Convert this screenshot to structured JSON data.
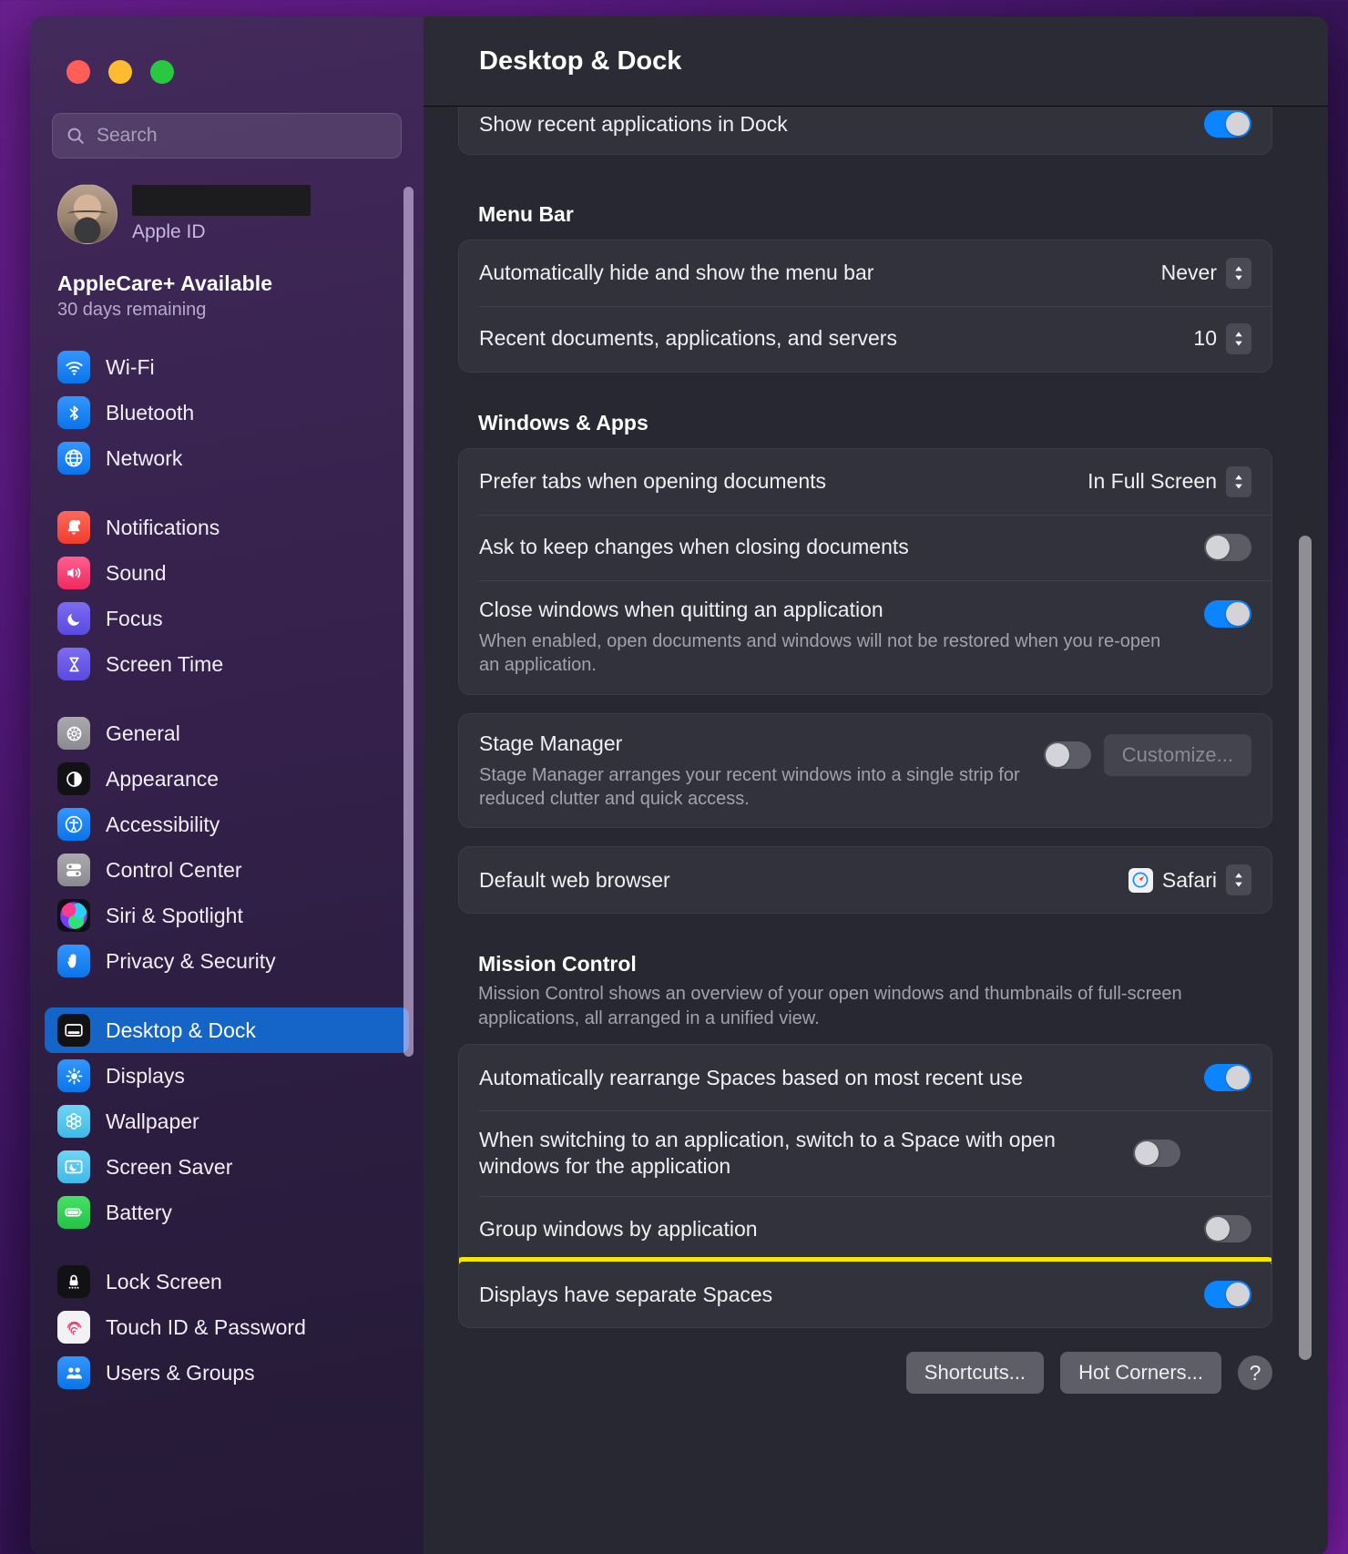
{
  "window": {
    "traffic_lights": [
      "close",
      "minimize",
      "zoom"
    ],
    "colors": {
      "close": "#ff5f57",
      "minimize": "#febc2e",
      "zoom": "#28c840",
      "accent": "#0a84ff",
      "selected_row": "#1565c9",
      "highlight": "#f5e800"
    }
  },
  "sidebar": {
    "search": {
      "placeholder": "Search",
      "value": ""
    },
    "account": {
      "name_redacted": true,
      "subtitle": "Apple ID"
    },
    "applecare": {
      "title": "AppleCare+ Available",
      "subtitle": "30 days remaining"
    },
    "groups": [
      {
        "items": [
          {
            "label": "Wi-Fi",
            "icon": "wifi-icon",
            "selected": false
          },
          {
            "label": "Bluetooth",
            "icon": "bluetooth-icon",
            "selected": false
          },
          {
            "label": "Network",
            "icon": "network-globe-icon",
            "selected": false
          }
        ]
      },
      {
        "items": [
          {
            "label": "Notifications",
            "icon": "notifications-bell-icon",
            "selected": false
          },
          {
            "label": "Sound",
            "icon": "sound-speaker-icon",
            "selected": false
          },
          {
            "label": "Focus",
            "icon": "focus-moon-icon",
            "selected": false
          },
          {
            "label": "Screen Time",
            "icon": "screen-time-hourglass-icon",
            "selected": false
          }
        ]
      },
      {
        "items": [
          {
            "label": "General",
            "icon": "general-gear-icon",
            "selected": false
          },
          {
            "label": "Appearance",
            "icon": "appearance-contrast-icon",
            "selected": false
          },
          {
            "label": "Accessibility",
            "icon": "accessibility-icon",
            "selected": false
          },
          {
            "label": "Control Center",
            "icon": "control-center-toggles-icon",
            "selected": false
          },
          {
            "label": "Siri & Spotlight",
            "icon": "siri-orb-icon",
            "selected": false
          },
          {
            "label": "Privacy & Security",
            "icon": "privacy-hand-icon",
            "selected": false
          }
        ]
      },
      {
        "items": [
          {
            "label": "Desktop & Dock",
            "icon": "desktop-dock-icon",
            "selected": true
          },
          {
            "label": "Displays",
            "icon": "displays-brightness-icon",
            "selected": false
          },
          {
            "label": "Wallpaper",
            "icon": "wallpaper-flower-icon",
            "selected": false
          },
          {
            "label": "Screen Saver",
            "icon": "screen-saver-icon",
            "selected": false
          },
          {
            "label": "Battery",
            "icon": "battery-icon",
            "selected": false
          }
        ]
      },
      {
        "items": [
          {
            "label": "Lock Screen",
            "icon": "lock-screen-padlock-icon",
            "selected": false
          },
          {
            "label": "Touch ID & Password",
            "icon": "touch-id-fingerprint-icon",
            "selected": false
          },
          {
            "label": "Users & Groups",
            "icon": "users-groups-icon",
            "selected": false
          }
        ]
      }
    ]
  },
  "detail": {
    "title": "Desktop & Dock",
    "dock_group": {
      "rows": [
        {
          "label": "Show recent applications in Dock",
          "control": "toggle",
          "value": "on"
        }
      ]
    },
    "menu_bar": {
      "section_title": "Menu Bar",
      "rows": [
        {
          "label": "Automatically hide and show the menu bar",
          "control": "popup",
          "value": "Never"
        },
        {
          "label": "Recent documents, applications, and servers",
          "control": "stepper",
          "value": "10"
        }
      ]
    },
    "windows_apps": {
      "section_title": "Windows & Apps",
      "rows": [
        {
          "label": "Prefer tabs when opening documents",
          "control": "popup",
          "value": "In Full Screen"
        },
        {
          "label": "Ask to keep changes when closing documents",
          "control": "toggle",
          "value": "off"
        },
        {
          "label": "Close windows when quitting an application",
          "sub": "When enabled, open documents and windows will not be restored when you re-open an application.",
          "control": "toggle",
          "value": "on"
        }
      ],
      "stage_manager": {
        "label": "Stage Manager",
        "sub": "Stage Manager arranges your recent windows into a single strip for reduced clutter and quick access.",
        "toggle": "off",
        "button": "Customize...",
        "button_disabled": true
      },
      "default_browser": {
        "label": "Default web browser",
        "value": "Safari",
        "icon": "safari-compass-icon"
      }
    },
    "mission_control": {
      "section_title": "Mission Control",
      "section_desc": "Mission Control shows an overview of your open windows and thumbnails of full-screen applications, all arranged in a unified view.",
      "rows": [
        {
          "label": "Automatically rearrange Spaces based on most recent use",
          "control": "toggle",
          "value": "on",
          "highlighted": false
        },
        {
          "label": "When switching to an application, switch to a Space with open windows for the application",
          "control": "toggle",
          "value": "off",
          "highlighted": false
        },
        {
          "label": "Group windows by application",
          "control": "toggle",
          "value": "off",
          "highlighted": false
        },
        {
          "label": "Displays have separate Spaces",
          "control": "toggle",
          "value": "on",
          "highlighted": true
        }
      ]
    },
    "footer": {
      "shortcuts_button": "Shortcuts...",
      "hot_corners_button": "Hot Corners...",
      "help_button": "?"
    }
  }
}
